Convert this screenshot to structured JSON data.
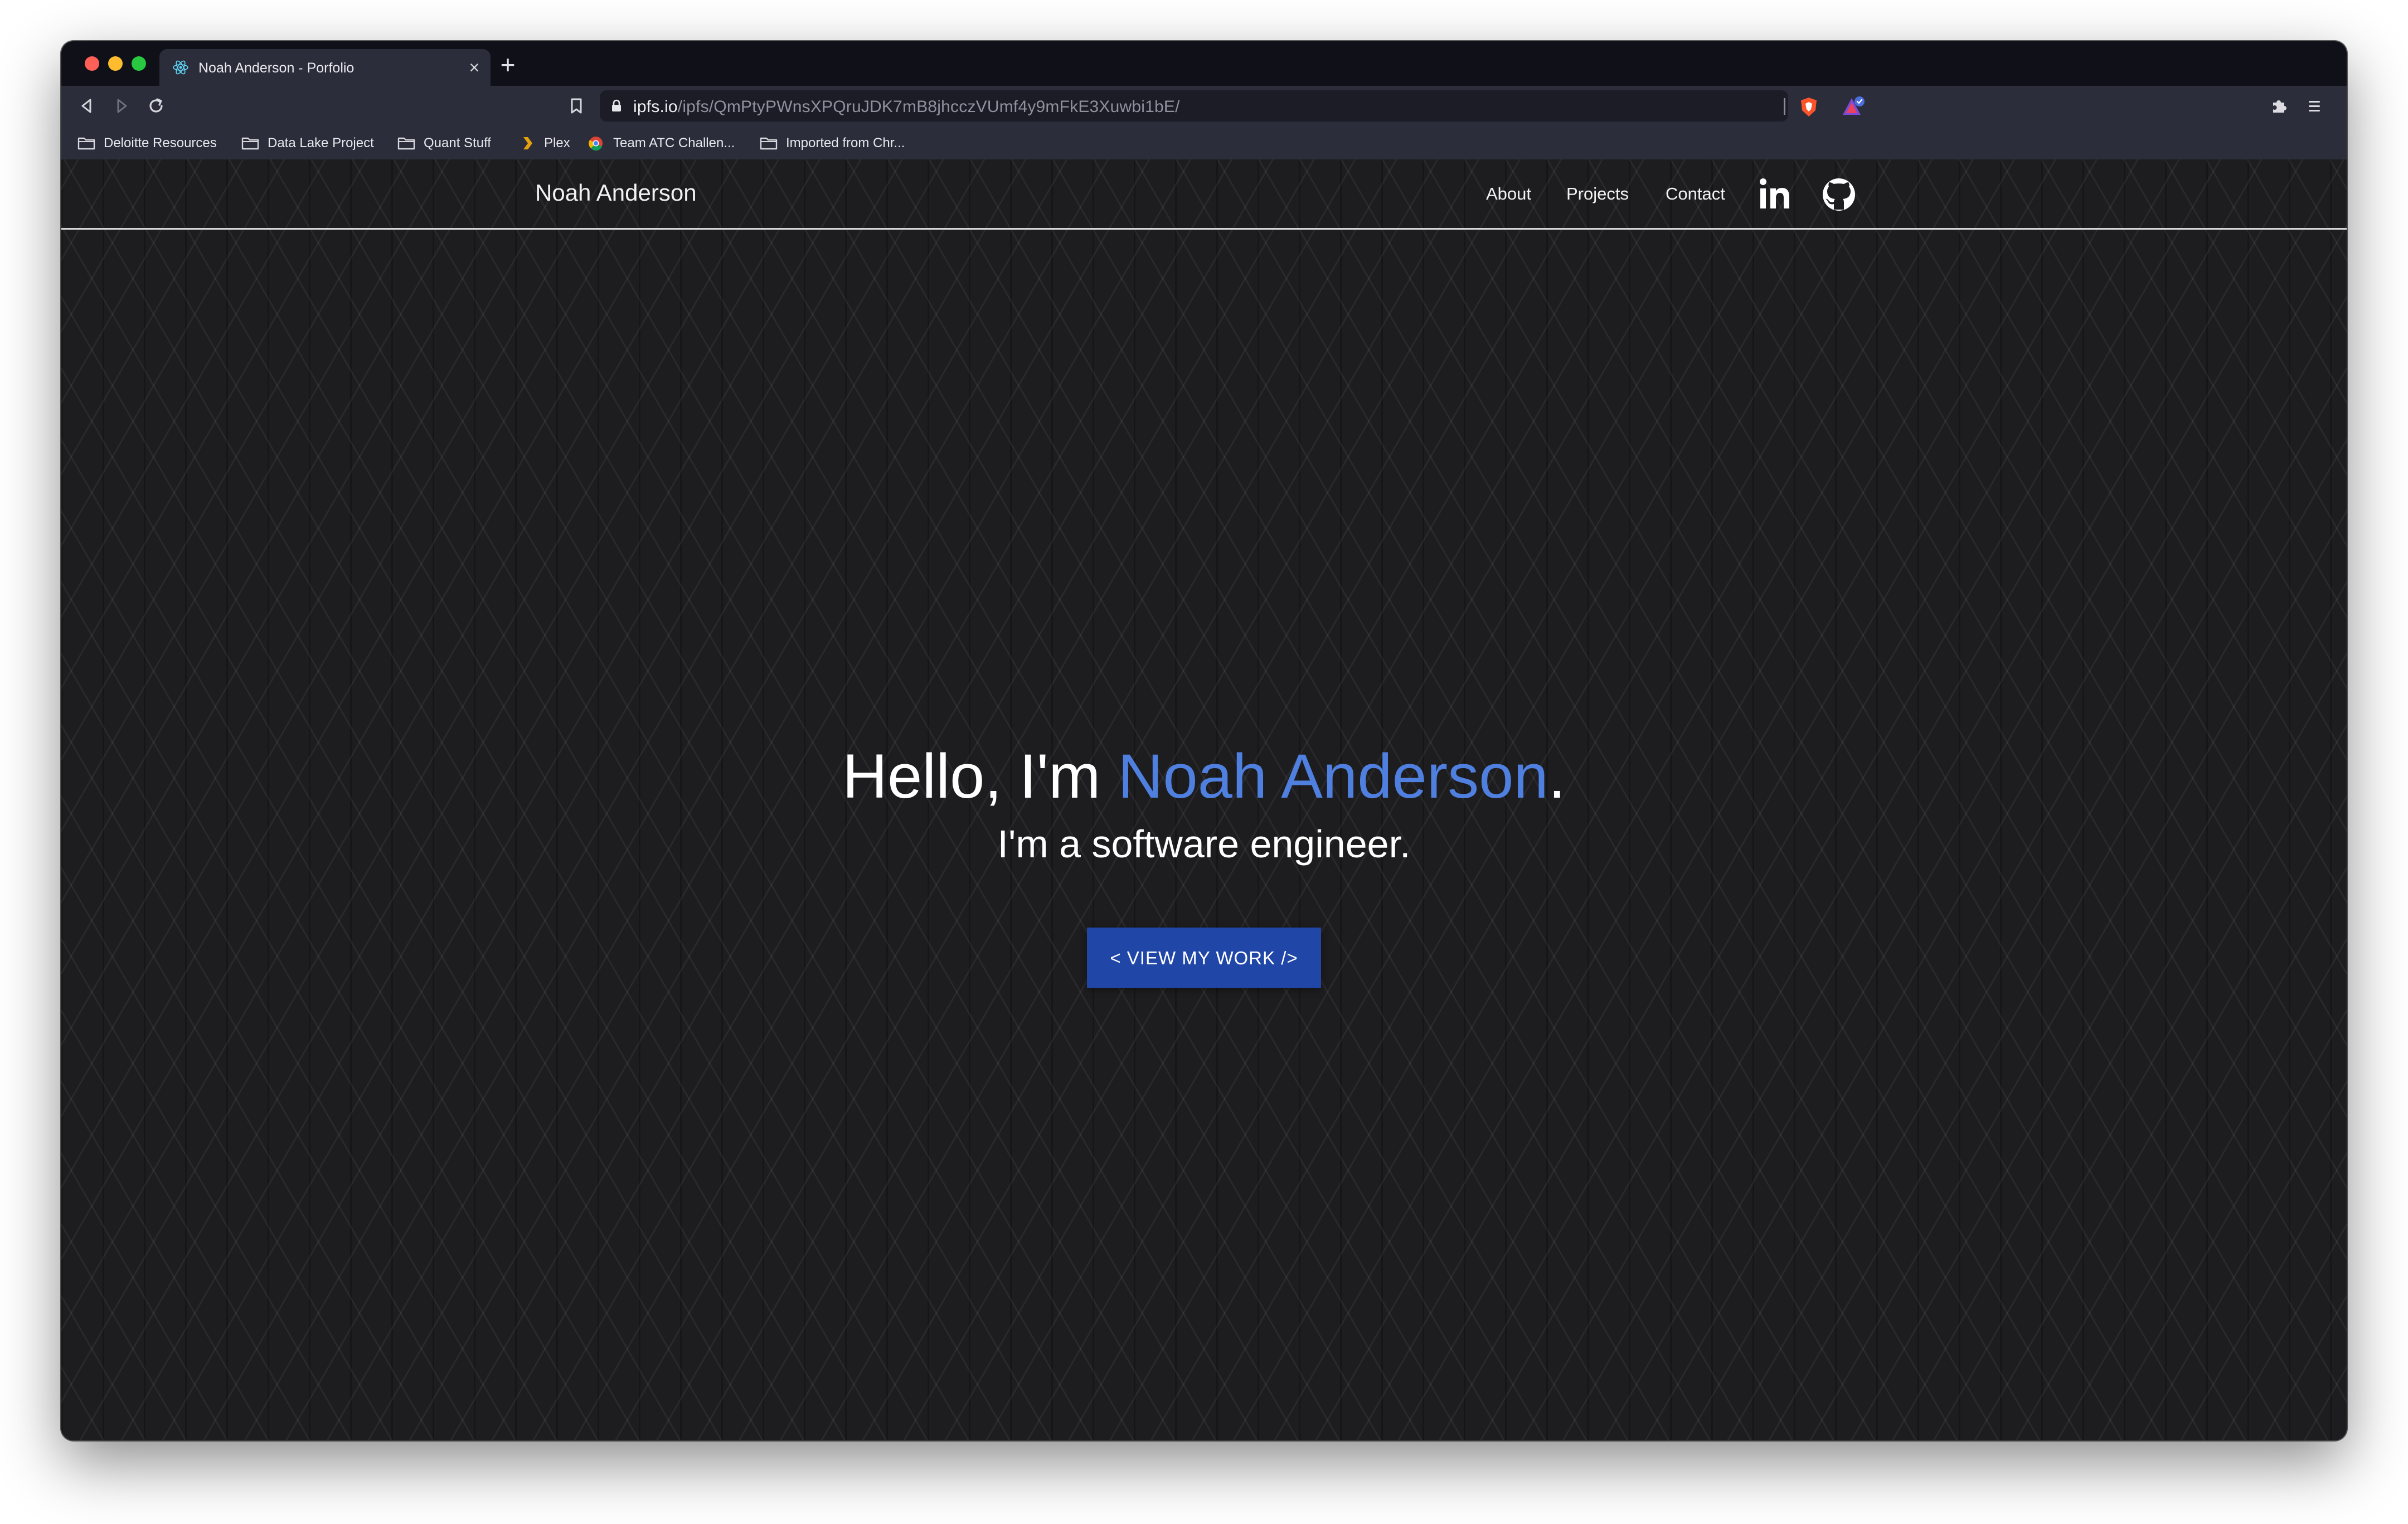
{
  "browser": {
    "tab": {
      "title": "Noah Anderson - Porfolio",
      "close_label": "×",
      "favicon": "react-icon"
    },
    "new_tab_label": "+",
    "url": {
      "host": "ipfs.io",
      "path": "/ipfs/QmPtyPWnsXPQruJDK7mB8jhcczVUmf4y9mFkE3Xuwbi1bE/"
    },
    "bookmarks": [
      {
        "label": "Deloitte Resources",
        "icon": "folder-icon"
      },
      {
        "label": "Data Lake Project",
        "icon": "folder-icon"
      },
      {
        "label": "Quant Stuff",
        "icon": "folder-icon"
      },
      {
        "label": "Plex",
        "icon": "plex-icon"
      },
      {
        "label": "Team ATC Challen...",
        "icon": "chrome-icon"
      },
      {
        "label": "Imported from Chr...",
        "icon": "folder-icon"
      }
    ],
    "colors": {
      "tabstrip": "#0f1018",
      "toolbar": "#2b2d3a",
      "traffic_red": "#fe5f57",
      "traffic_yellow": "#febc2e",
      "traffic_green": "#28c840"
    }
  },
  "site": {
    "brand": "Noah Anderson",
    "nav": {
      "about": "About",
      "projects": "Projects",
      "contact": "Contact"
    },
    "social_icons": [
      "linkedin-icon",
      "github-icon"
    ],
    "hero": {
      "greeting_prefix": "Hello, I'm ",
      "greeting_name": "Noah Anderson",
      "greeting_suffix": ".",
      "subtitle": "I'm a software engineer.",
      "cta_label": "< VIEW MY WORK />"
    },
    "colors": {
      "background": "#1d1d1f",
      "accent": "#4f7fdf",
      "cta": "#2046a8",
      "text": "#ffffff"
    }
  }
}
